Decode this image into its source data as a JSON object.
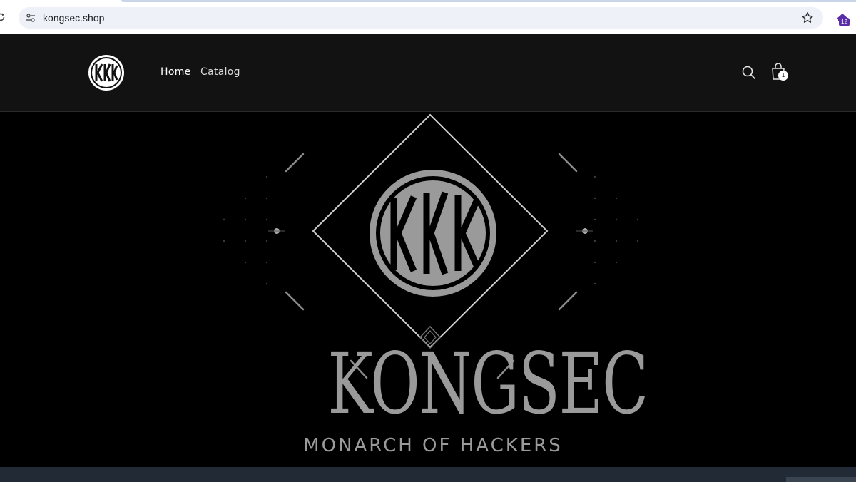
{
  "browser": {
    "url": "kongsec.shop",
    "extension_badge": "12",
    "icons": [
      "reload-icon",
      "site-info-icon",
      "star-icon",
      "extension-icon"
    ]
  },
  "header": {
    "logo_icon": "kkk-monogram-logo",
    "nav": [
      {
        "label": "Home",
        "active": true
      },
      {
        "label": "Catalog",
        "active": false
      }
    ],
    "cart_count": "1",
    "icons": [
      "search-icon",
      "cart-icon"
    ]
  },
  "hero": {
    "emblem": "kkk-monogram-diamond-emblem",
    "title": "KONGSEC",
    "subtitle": "MONARCH OF HACKERS"
  },
  "colors": {
    "header_bg": "#121212",
    "hero_bg": "#000000",
    "hero_text": "#9a9a9a",
    "bottom_strip": "#212a35",
    "omnibox_bg": "#eef2f8"
  }
}
